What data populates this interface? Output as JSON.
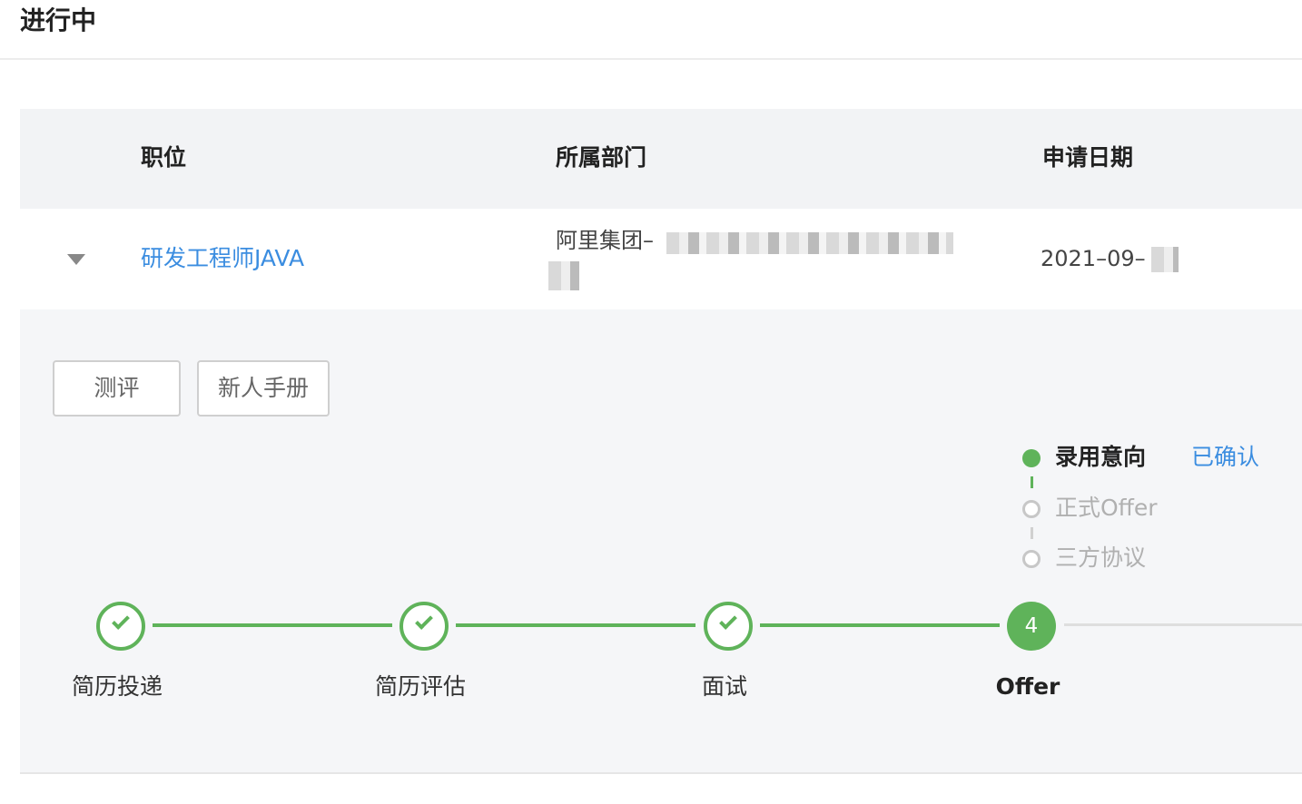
{
  "page": {
    "title": "进行中"
  },
  "table": {
    "headers": {
      "position": "职位",
      "department": "所属部门",
      "date": "申请日期"
    },
    "row": {
      "position": "研发工程师JAVA",
      "department": "阿里集团–",
      "date": "2021–09–"
    }
  },
  "actions": {
    "assessment": "测评",
    "handbook": "新人手册"
  },
  "offer_substeps": [
    {
      "label": "录用意向",
      "state": "done",
      "status": "已确认"
    },
    {
      "label": "正式Offer",
      "state": "todo"
    },
    {
      "label": "三方协议",
      "state": "todo"
    }
  ],
  "progress": {
    "steps": [
      {
        "label": "简历投递",
        "state": "done"
      },
      {
        "label": "简历评估",
        "state": "done"
      },
      {
        "label": "面试",
        "state": "done"
      },
      {
        "label": "Offer",
        "state": "active",
        "number": "4"
      }
    ]
  },
  "colors": {
    "accent_green": "#5fb35a",
    "link_blue": "#3b8de0"
  }
}
